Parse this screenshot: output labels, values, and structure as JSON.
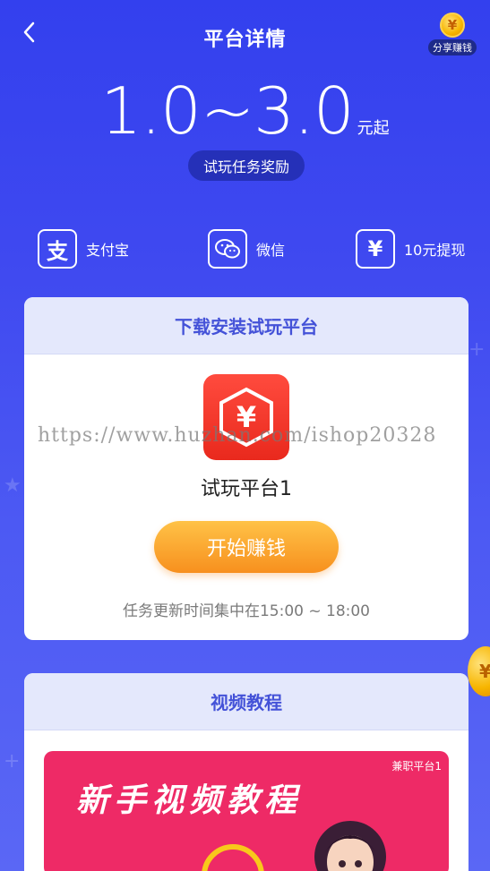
{
  "header": {
    "title": "平台详情",
    "share_label": "分享赚钱",
    "share_coin_symbol": "¥"
  },
  "reward": {
    "amount": "1.0~3.0",
    "unit": "元起",
    "pill": "试玩任务奖励"
  },
  "features": [
    {
      "icon": "alipay-icon",
      "glyph": "支",
      "label": "支付宝"
    },
    {
      "icon": "wechat-icon",
      "glyph": "",
      "label": "微信"
    },
    {
      "icon": "yuan-icon",
      "glyph": "¥",
      "label": "10元提现"
    }
  ],
  "download_card": {
    "heading": "下载安装试玩平台",
    "app_name": "试玩平台1",
    "app_glyph": "¥",
    "start_button": "开始赚钱",
    "task_time": "任务更新时间集中在15:00 ~ 18:00"
  },
  "video_card": {
    "heading": "视频教程",
    "thumb_tag": "兼职平台1",
    "thumb_title": "新手视频教程"
  },
  "watermark": "https://www.huzhan.com/ishop20328",
  "colors": {
    "background_top": "#3340ee",
    "card_header_bg": "#e4e8fc",
    "card_header_text": "#4452d8",
    "start_button": "#f7901e",
    "app_icon": "#e9291d",
    "video_thumb": "#ee2a66"
  }
}
